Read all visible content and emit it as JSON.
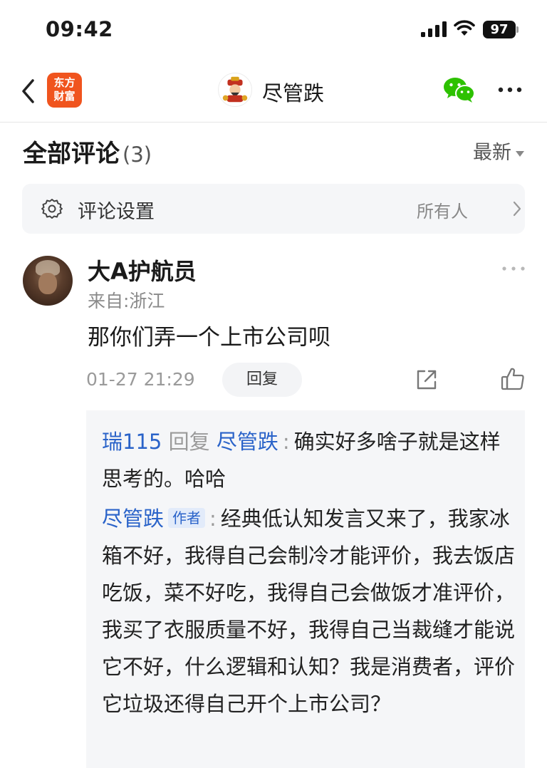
{
  "status_bar": {
    "time": "09:42",
    "battery": "97"
  },
  "nav": {
    "logo_line1": "东方",
    "logo_line2": "财富",
    "title": "尽管跌"
  },
  "comments": {
    "title": "全部评论",
    "count": "(3)",
    "sort": "最新"
  },
  "settings": {
    "label": "评论设置",
    "value": "所有人"
  },
  "comment": {
    "username": "大A护航员",
    "location": "来自:浙江",
    "text": "那你们弄一个上市公司呗",
    "time": "01-27 21:29",
    "reply_label": "回复"
  },
  "replies": [
    {
      "user": "瑞115",
      "verb": "回复",
      "target": "尽管跌",
      "colon": ":",
      "text": "确实好多啥子就是这样思考的。哈哈"
    },
    {
      "user": "尽管跌",
      "tag": "作者",
      "colon": ":",
      "text": "经典低认知发言又来了，我家冰箱不好，我得自己会制冷才能评价，我去饭店吃饭，菜不好吃，我得自己会做饭才准评价，我买了衣服质量不好，我得自己当裁缝才能说它不好，什么逻辑和认知？我是消费者，评价它垃圾还得自己开个上市公司？"
    }
  ],
  "colors": {
    "accent_blue": "#2a63c9",
    "brand_orange": "#f0541e",
    "wechat_green": "#2dc100"
  }
}
